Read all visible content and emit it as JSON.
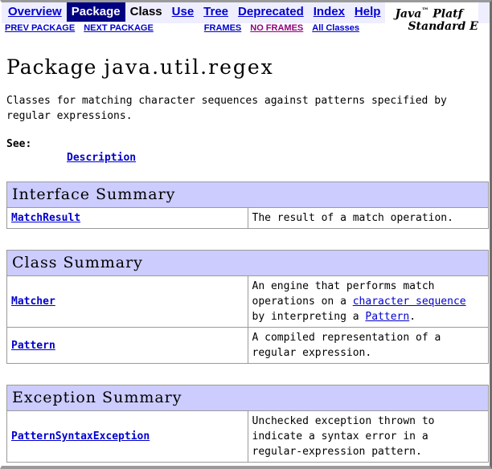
{
  "navbar": {
    "items": [
      {
        "label": "Overview",
        "state": "link"
      },
      {
        "label": "Package",
        "state": "current"
      },
      {
        "label": "Class",
        "state": "plain"
      },
      {
        "label": "Use",
        "state": "link"
      },
      {
        "label": "Tree",
        "state": "link"
      },
      {
        "label": "Deprecated",
        "state": "link"
      },
      {
        "label": "Index",
        "state": "link"
      },
      {
        "label": "Help",
        "state": "link"
      }
    ],
    "brand_line1": "Java",
    "brand_tm": "™",
    "brand_line1_rest": " Platf",
    "brand_line2": "Standard E",
    "subnav_left": [
      {
        "label": "PREV PACKAGE",
        "state": "link"
      },
      {
        "label": "NEXT PACKAGE",
        "state": "link"
      }
    ],
    "subnav_right": [
      {
        "label": "FRAMES",
        "state": "link"
      },
      {
        "label": "NO FRAMES",
        "state": "visited"
      },
      {
        "label": "All Classes",
        "state": "link"
      }
    ],
    "colors": {
      "nav_background": "#eeeeff",
      "current_background": "#000080",
      "link": "#0000cf",
      "visited_link": "#93007b",
      "table_caption_background": "#ccccff",
      "border": "#9a9a9a"
    }
  },
  "main": {
    "title_prefix": "Package ",
    "title_package": "java.util.regex",
    "description": "Classes for matching character sequences against patterns specified by regular expressions.",
    "see_label": "See:",
    "see_link": "Description"
  },
  "tables": {
    "interface_summary": {
      "caption": "Interface Summary",
      "rows": [
        {
          "name": "MatchResult",
          "desc_parts": [
            {
              "text": "The result of a match operation.",
              "type": "text"
            }
          ]
        }
      ]
    },
    "class_summary": {
      "caption": "Class Summary",
      "rows": [
        {
          "name": "Matcher",
          "desc_parts": [
            {
              "text": "An engine that performs match operations on a ",
              "type": "text"
            },
            {
              "text": "character sequence",
              "type": "link"
            },
            {
              "text": " by interpreting a ",
              "type": "text"
            },
            {
              "text": "Pattern",
              "type": "link"
            },
            {
              "text": ".",
              "type": "text"
            }
          ]
        },
        {
          "name": "Pattern",
          "desc_parts": [
            {
              "text": "A compiled representation of a regular expression.",
              "type": "text"
            }
          ]
        }
      ]
    },
    "exception_summary": {
      "caption": "Exception Summary",
      "rows": [
        {
          "name": "PatternSyntaxException",
          "desc_parts": [
            {
              "text": "Unchecked exception thrown to indicate a syntax error in a regular-expression pattern.",
              "type": "text"
            }
          ]
        }
      ]
    }
  }
}
